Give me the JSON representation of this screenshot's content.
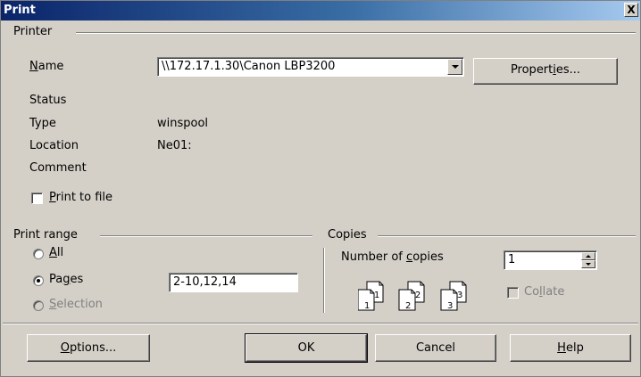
{
  "window": {
    "title": "Print",
    "close_glyph": "X"
  },
  "printer": {
    "group_label": "Printer",
    "name_label_pre": "",
    "name_label_key": "N",
    "name_label_post": "ame",
    "name_value": "\\\\172.17.1.30\\Canon LBP3200",
    "properties_pre": "Propert",
    "properties_key": "i",
    "properties_post": "es...",
    "status_label": "Status",
    "status_value": "",
    "type_label": "Type",
    "type_value": "winspool",
    "location_label": "Location",
    "location_value": "Ne01:",
    "comment_label": "Comment",
    "comment_value": "",
    "print_to_file_pre": "",
    "print_to_file_key": "P",
    "print_to_file_post": "rint to file",
    "print_to_file_checked": false
  },
  "print_range": {
    "group_label": "Print range",
    "all_pre": "",
    "all_key": "A",
    "all_post": "ll",
    "pages_pre": "Pa",
    "pages_key": "g",
    "pages_post": "es",
    "selection_pre": "",
    "selection_key": "S",
    "selection_post": "election",
    "selected": "pages",
    "pages_value": "2-10,12,14"
  },
  "copies": {
    "group_label": "Copies",
    "number_pre": "Number of ",
    "number_key": "c",
    "number_post": "opies",
    "number_value": "1",
    "collate_pre": "Co",
    "collate_key": "l",
    "collate_post": "late",
    "collate_checked": false,
    "collate_icon_numbers": [
      "1",
      "1",
      "2",
      "2",
      "3",
      "3"
    ]
  },
  "buttons": {
    "options_pre": "",
    "options_key": "O",
    "options_post": "ptions...",
    "ok": "OK",
    "cancel": "Cancel",
    "help_pre": "",
    "help_key": "H",
    "help_post": "elp"
  }
}
